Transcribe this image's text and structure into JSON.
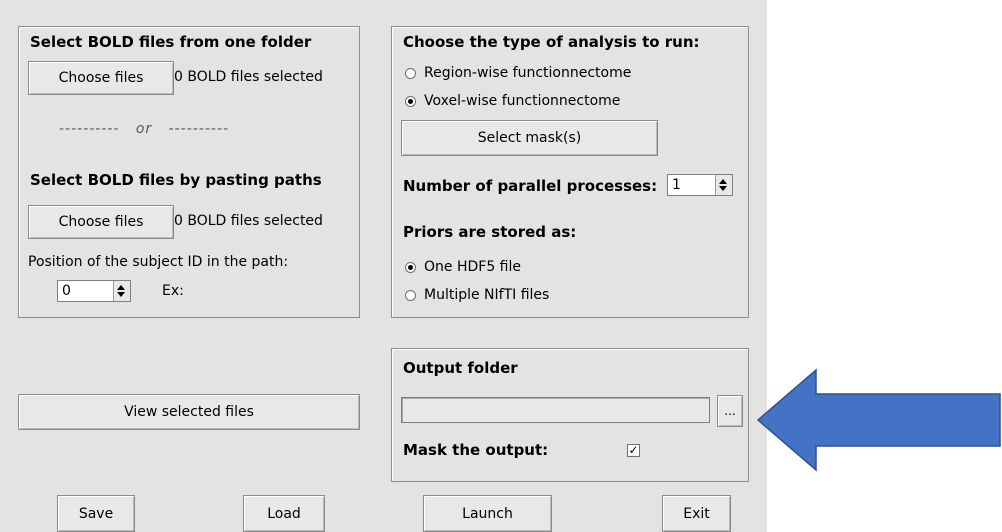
{
  "left_panel": {
    "folder_heading": "Select BOLD files from one folder",
    "folder_choose_label": "Choose files",
    "folder_count": "0 BOLD files selected",
    "or_divider": "----------   or   ----------",
    "paste_heading": "Select BOLD files by pasting paths",
    "paste_choose_label": "Choose files",
    "paste_count": "0 BOLD files selected",
    "position_label": "Position of the subject ID in the path:",
    "position_value": "0",
    "example_label": "Ex:"
  },
  "view_files_label": "View selected files",
  "analysis_panel": {
    "heading": "Choose the type of analysis to run:",
    "options": [
      {
        "label": "Region-wise functionnectome",
        "selected": false
      },
      {
        "label": "Voxel-wise functionnectome",
        "selected": true
      }
    ],
    "mask_button_label": "Select mask(s)",
    "parallel_label": "Number of parallel processes:",
    "parallel_value": "1",
    "priors_heading": "Priors are stored as:",
    "priors_options": [
      {
        "label": "One HDF5 file",
        "selected": true
      },
      {
        "label": "Multiple NIfTI files",
        "selected": false
      }
    ]
  },
  "output_panel": {
    "heading": "Output folder",
    "path_value": "",
    "browse_label": "...",
    "mask_output_label": "Mask the output:",
    "mask_output_checked": true,
    "check_glyph": "✓"
  },
  "footer": {
    "save_label": "Save",
    "load_label": "Load",
    "launch_label": "Launch",
    "exit_label": "Exit"
  },
  "annotation_color": "#4472c4"
}
